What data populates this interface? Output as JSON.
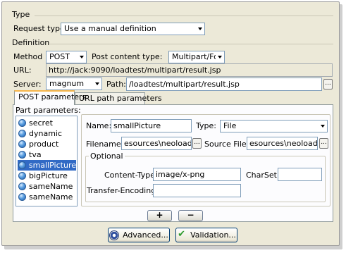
{
  "type_section": {
    "title": "Type",
    "request_type_label": "Request type:",
    "request_type_value": "Use a manual definition"
  },
  "definition": {
    "title": "Definition",
    "method_label": "Method :",
    "method_value": "POST",
    "post_content_type_label": "Post content type:",
    "post_content_type_value": "Multipart/Form-D...",
    "url_label": "URL:",
    "url_value": "http://jack:9090/loadtest/multipart/result.jsp",
    "server_label": "Server:",
    "server_value": "magnum",
    "path_label": "Path:",
    "path_value": "/loadtest/multipart/result.jsp",
    "browse_label": "..."
  },
  "tabs": [
    {
      "label": "POST parameters",
      "active": true
    },
    {
      "label": "URL path parameters",
      "active": false
    }
  ],
  "parts": {
    "title": "Part parameters:",
    "items": [
      {
        "label": "secret",
        "selected": false
      },
      {
        "label": "dynamic",
        "selected": false
      },
      {
        "label": "product",
        "selected": false
      },
      {
        "label": "tva",
        "selected": false
      },
      {
        "label": "smallPicture",
        "selected": true
      },
      {
        "label": "bigPicture",
        "selected": false
      },
      {
        "label": "sameName",
        "selected": false
      },
      {
        "label": "sameName",
        "selected": false
      }
    ]
  },
  "detail": {
    "name_label": "Name:",
    "name_value": "smallPicture",
    "type_label": "Type:",
    "type_value": "File",
    "filename_label": "Filename:",
    "filename_value": "esources\\neoload.png",
    "source_file_label": "Source File:",
    "source_file_value": "esources\\neoload.png",
    "browse_label": "...",
    "optional_title": "Optional",
    "content_type_label": "Content-Type:",
    "content_type_value": "image/x-png",
    "charset_label": "CharSet:",
    "charset_value": "",
    "transfer_encoding_label": "Transfer-Encoding:",
    "transfer_encoding_value": ""
  },
  "list_buttons": {
    "add_label": "+",
    "remove_label": "−"
  },
  "bottom_buttons": {
    "advanced_label": "Advanced...",
    "validation_label": "Validation..."
  },
  "colors": {
    "panel_bg": "#ece9d8",
    "selection": "#316ac5",
    "active_tab_accent": "#f7b64a"
  },
  "icons": {
    "list_item_icon": "blue-ball-icon",
    "advanced_icon": "gear-icon",
    "validation_icon": "checkmark-icon"
  }
}
